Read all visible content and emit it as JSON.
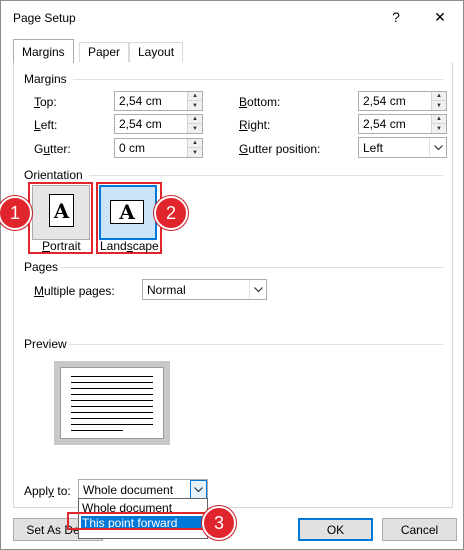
{
  "dialog": {
    "title": "Page Setup",
    "help_glyph": "?",
    "close_glyph": "✕"
  },
  "tabs": [
    {
      "label": "Margins",
      "active": true
    },
    {
      "label": "Paper",
      "active": false
    },
    {
      "label": "Layout",
      "active": false
    }
  ],
  "margins": {
    "section": "Margins",
    "top": {
      "label_ul": "T",
      "label_rest": "op:",
      "value": "2,54 cm"
    },
    "left": {
      "label_ul": "L",
      "label_rest": "eft:",
      "value": "2,54 cm"
    },
    "gutter": {
      "label_pre": "G",
      "label_ul": "u",
      "label_rest": "tter:",
      "value": "0 cm"
    },
    "bottom": {
      "label_ul": "B",
      "label_rest": "ottom:",
      "value": "2,54 cm"
    },
    "right": {
      "label_ul": "R",
      "label_rest": "ight:",
      "value": "2,54 cm"
    },
    "gutter_position": {
      "label_ul": "G",
      "label_rest": "utter position:",
      "value": "Left"
    }
  },
  "orientation": {
    "section": "Orientation",
    "portrait": {
      "label_ul": "P",
      "label_rest": "ortrait",
      "glyph": "A"
    },
    "landscape": {
      "label_pre": "Land",
      "label_ul": "s",
      "label_rest": "cape",
      "glyph": "A",
      "selected": true
    }
  },
  "pages": {
    "section": "Pages",
    "multiple_label_ul": "M",
    "multiple_label_rest": "ultiple pages:",
    "multiple_value": "Normal"
  },
  "preview": {
    "section": "Preview"
  },
  "apply": {
    "label_pre": "Appl",
    "label_ul": "y",
    "label_rest": " to:",
    "value": "Whole document",
    "options": [
      "Whole document",
      "This point forward"
    ],
    "highlighted": "This point forward"
  },
  "footer": {
    "set_default": "Set As Defa",
    "ok": "OK",
    "cancel": "Cancel"
  },
  "annotations": {
    "badge1": "1",
    "badge2": "2",
    "badge3": "3",
    "color": "#e0262c"
  },
  "colors": {
    "accent": "#0078d7",
    "highlight_red": "#e0262c"
  }
}
